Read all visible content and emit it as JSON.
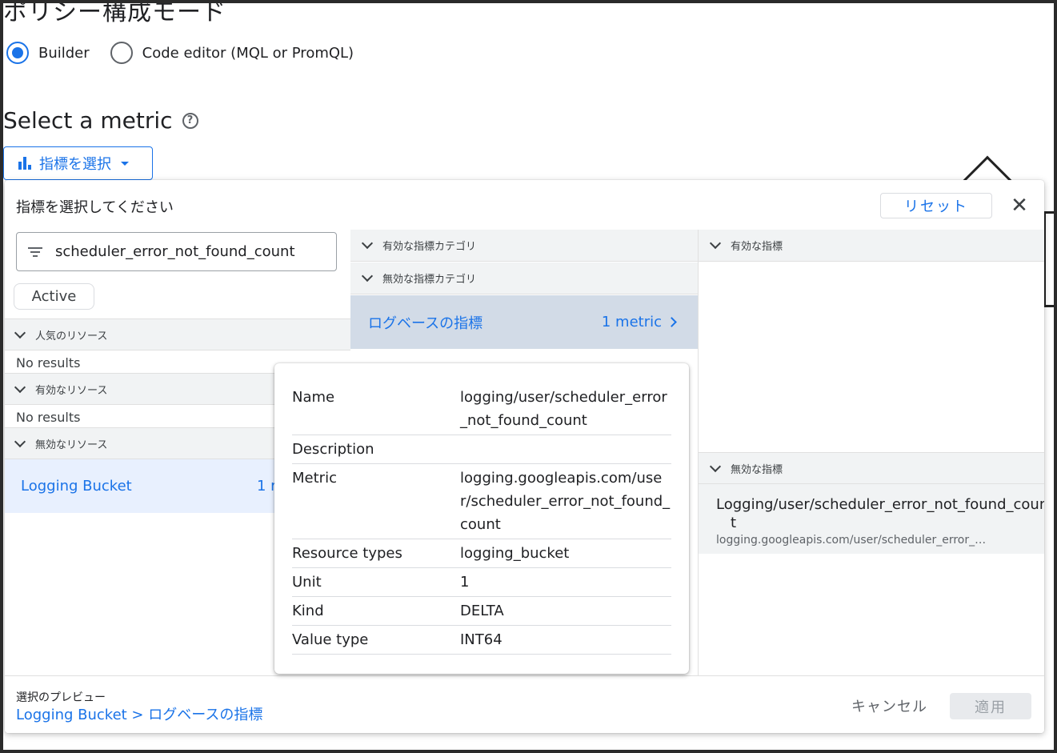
{
  "page": {
    "title": "ポリシー構成モード",
    "modes": [
      {
        "label": "Builder",
        "checked": true
      },
      {
        "label": "Code editor (MQL or PromQL)",
        "checked": false
      }
    ],
    "section_title": "Select a metric",
    "metric_button": "指標を選択"
  },
  "dialog": {
    "title": "指標を選択してください",
    "reset": "リセット",
    "filter_value": "scheduler_error_not_found_count",
    "chip": "Active",
    "resources": {
      "popular_header": "人気のリソース",
      "popular_empty": "No results",
      "active_header": "有効なリソース",
      "active_empty": "No results",
      "inactive_header": "無効なリソース",
      "selected_name": "Logging Bucket",
      "selected_count": "1 r"
    },
    "categories": {
      "active_header": "有効な指標カテゴリ",
      "inactive_header": "無効な指標カテゴリ",
      "selected_name": "ログベースの指標",
      "selected_count": "1 metric"
    },
    "metrics": {
      "active_header": "有効な指標",
      "inactive_header": "無効な指標",
      "item_name_line1": "Logging/user/scheduler_error_not_found_coun",
      "item_name_line2": "t",
      "item_sub": "logging.googleapis.com/user/scheduler_error_no..."
    },
    "footer": {
      "preview_label": "選択のプレビュー",
      "preview_path": "Logging Bucket > ログベースの指標",
      "cancel": "キャンセル",
      "apply": "適用"
    }
  },
  "tooltip": {
    "rows": [
      {
        "label": "Name",
        "value": "logging/user/scheduler_error_not_found_count"
      },
      {
        "label": "Description",
        "value": ""
      },
      {
        "label": "Metric",
        "value": "logging.googleapis.com/user/scheduler_error_not_found_count"
      },
      {
        "label": "Resource types",
        "value": "logging_bucket"
      },
      {
        "label": "Unit",
        "value": "1"
      },
      {
        "label": "Kind",
        "value": "DELTA"
      },
      {
        "label": "Value type",
        "value": "INT64"
      }
    ]
  },
  "colors": {
    "accent": "#1a73e8",
    "selected_bg": "#e8f0fe",
    "category_selected_bg": "#d2dbe7",
    "header_bg": "#f1f3f4"
  }
}
